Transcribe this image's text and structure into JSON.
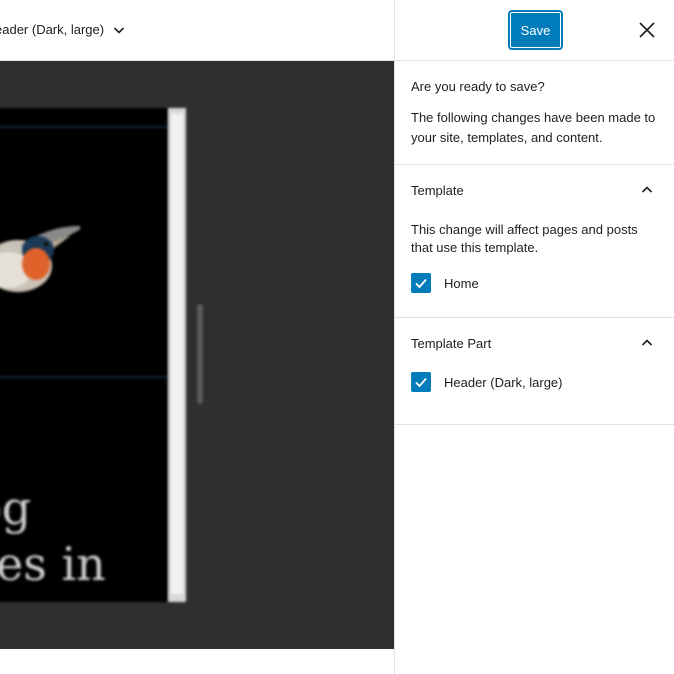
{
  "editor": {
    "document_title": "eader (Dark, large)",
    "preview_text_line1": "og",
    "preview_text_line2": "res in"
  },
  "panel": {
    "save_label": "Save",
    "close_icon": "close-icon",
    "intro": {
      "heading": "Are you ready to save?",
      "body": "The following changes have been made to your site, templates, and content."
    },
    "sections": [
      {
        "title": "Template",
        "description": "This change will affect pages and posts that use this template.",
        "items": [
          {
            "label": "Home",
            "checked": true
          }
        ]
      },
      {
        "title": "Template Part",
        "items": [
          {
            "label": "Header (Dark, large)",
            "checked": true
          }
        ]
      }
    ]
  },
  "colors": {
    "accent": "#007cba",
    "canvas_bg": "#2f2f2f",
    "border": "#e0e0e0"
  }
}
